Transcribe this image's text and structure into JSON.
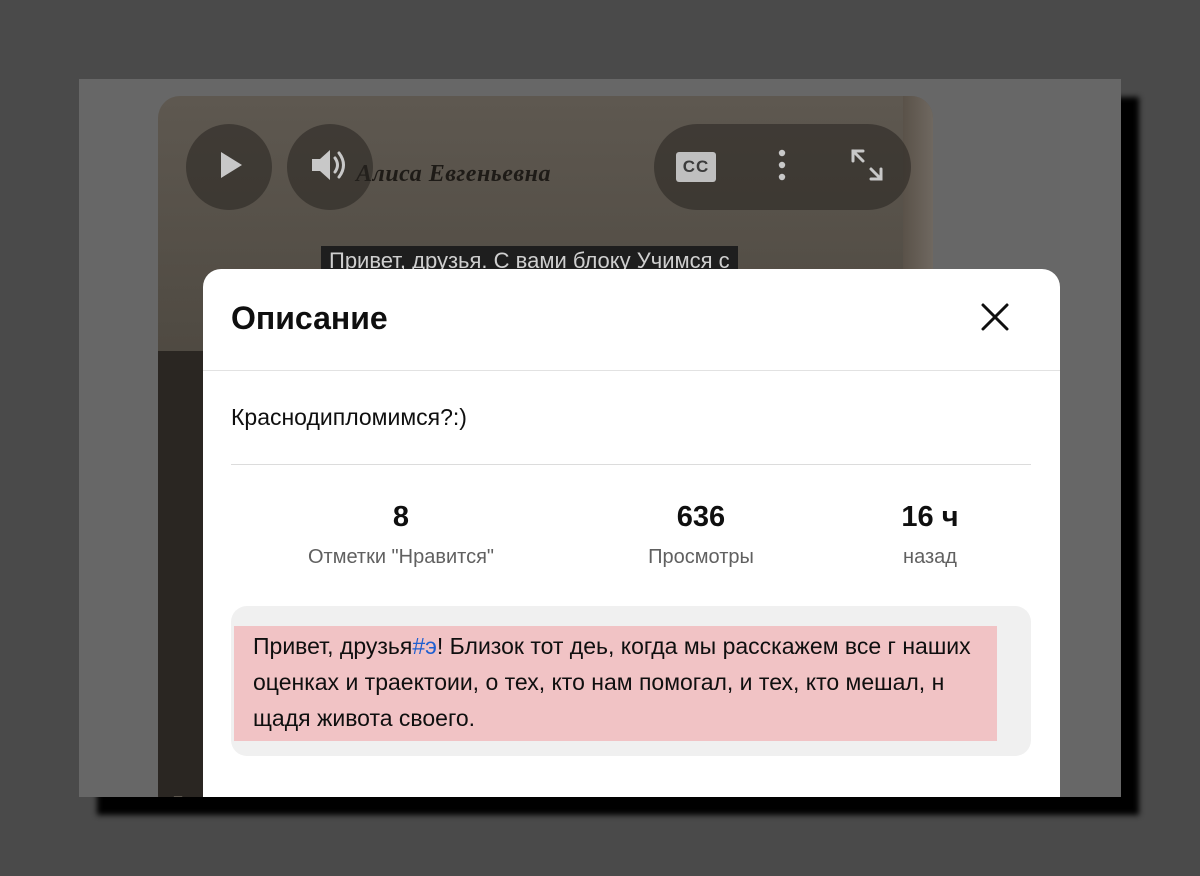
{
  "player": {
    "video_title": "Алиса Евгеньевна",
    "caption": "Привет, друзья. С вами блоку Учимся с",
    "corner_glyph": "I",
    "controls": {
      "play_icon": "play-icon",
      "volume_icon": "volume-icon",
      "cc_label": "CC",
      "more_icon": "more-vertical-icon",
      "fullscreen_icon": "fullscreen-icon"
    }
  },
  "modal": {
    "title": "Описание",
    "close_icon": "close-icon",
    "video_name": "Краснодипломимся?:)",
    "stats": [
      {
        "value": "8",
        "label": "Отметки \"Нравится\""
      },
      {
        "value": "636",
        "label": "Просмотры"
      },
      {
        "value": "16 ч",
        "label": "назад"
      }
    ],
    "description": {
      "before_tag": "Привет, друзья",
      "hashtag": "#э",
      "after_tag": "! Близок тот деь, когда мы расскажем все г наших оценках и траектоии, о тех, кто нам помогал, и тех, кто мешал, н щадя живота своего."
    }
  },
  "colors": {
    "background": "#4a4a4a",
    "modal_bg": "#ffffff",
    "highlight": "#f1c3c5",
    "hashtag": "#1e5fd0"
  }
}
